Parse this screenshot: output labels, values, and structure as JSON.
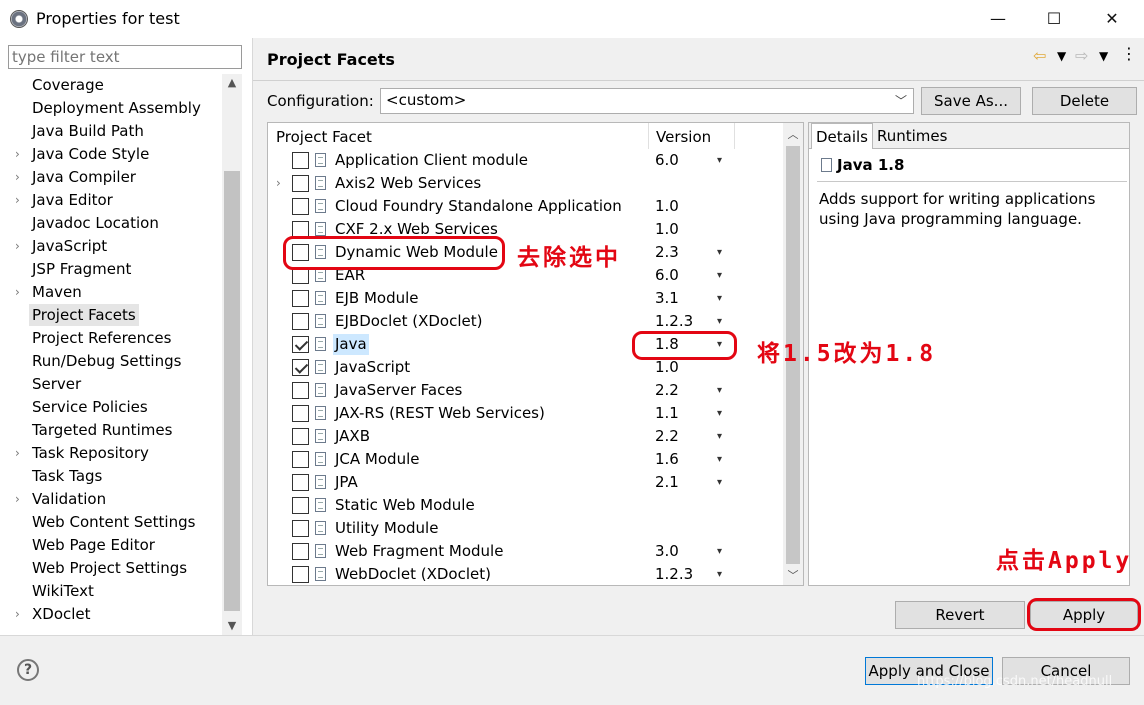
{
  "window": {
    "title": "Properties for test",
    "minimize_glyph": "—",
    "maximize_glyph": "☐",
    "close_glyph": "✕"
  },
  "filter": {
    "placeholder": "type filter text"
  },
  "tree": [
    {
      "label": "Coverage",
      "expandable": false,
      "selected": false
    },
    {
      "label": "Deployment Assembly",
      "expandable": false,
      "selected": false
    },
    {
      "label": "Java Build Path",
      "expandable": false,
      "selected": false
    },
    {
      "label": "Java Code Style",
      "expandable": true,
      "selected": false
    },
    {
      "label": "Java Compiler",
      "expandable": true,
      "selected": false
    },
    {
      "label": "Java Editor",
      "expandable": true,
      "selected": false
    },
    {
      "label": "Javadoc Location",
      "expandable": false,
      "selected": false
    },
    {
      "label": "JavaScript",
      "expandable": true,
      "selected": false
    },
    {
      "label": "JSP Fragment",
      "expandable": false,
      "selected": false
    },
    {
      "label": "Maven",
      "expandable": true,
      "selected": false
    },
    {
      "label": "Project Facets",
      "expandable": false,
      "selected": true
    },
    {
      "label": "Project References",
      "expandable": false,
      "selected": false
    },
    {
      "label": "Run/Debug Settings",
      "expandable": false,
      "selected": false
    },
    {
      "label": "Server",
      "expandable": false,
      "selected": false
    },
    {
      "label": "Service Policies",
      "expandable": false,
      "selected": false
    },
    {
      "label": "Targeted Runtimes",
      "expandable": false,
      "selected": false
    },
    {
      "label": "Task Repository",
      "expandable": true,
      "selected": false
    },
    {
      "label": "Task Tags",
      "expandable": false,
      "selected": false
    },
    {
      "label": "Validation",
      "expandable": true,
      "selected": false
    },
    {
      "label": "Web Content Settings",
      "expandable": false,
      "selected": false
    },
    {
      "label": "Web Page Editor",
      "expandable": false,
      "selected": false
    },
    {
      "label": "Web Project Settings",
      "expandable": false,
      "selected": false
    },
    {
      "label": "WikiText",
      "expandable": false,
      "selected": false
    },
    {
      "label": "XDoclet",
      "expandable": true,
      "selected": false
    }
  ],
  "page": {
    "title": "Project Facets",
    "config_label": "Configuration:",
    "config_value": "<custom>",
    "save_as": "Save As...",
    "delete": "Delete",
    "col_facet": "Project Facet",
    "col_version": "Version",
    "facets": [
      {
        "name": "Application Client module",
        "version": "6.0",
        "checked": false,
        "dropdown": true,
        "expand": false,
        "highlight": false
      },
      {
        "name": "Axis2 Web Services",
        "version": "",
        "checked": false,
        "dropdown": false,
        "expand": true,
        "highlight": false
      },
      {
        "name": "Cloud Foundry Standalone Application",
        "version": "1.0",
        "checked": false,
        "dropdown": false,
        "expand": false,
        "highlight": false
      },
      {
        "name": "CXF 2.x Web Services",
        "version": "1.0",
        "checked": false,
        "dropdown": false,
        "expand": false,
        "highlight": false
      },
      {
        "name": "Dynamic Web Module",
        "version": "2.3",
        "checked": false,
        "dropdown": true,
        "expand": false,
        "highlight": false
      },
      {
        "name": "EAR",
        "version": "6.0",
        "checked": false,
        "dropdown": true,
        "expand": false,
        "highlight": false
      },
      {
        "name": "EJB Module",
        "version": "3.1",
        "checked": false,
        "dropdown": true,
        "expand": false,
        "highlight": false
      },
      {
        "name": "EJBDoclet (XDoclet)",
        "version": "1.2.3",
        "checked": false,
        "dropdown": true,
        "expand": false,
        "highlight": false
      },
      {
        "name": "Java",
        "version": "1.8",
        "checked": true,
        "dropdown": true,
        "expand": false,
        "highlight": true
      },
      {
        "name": "JavaScript",
        "version": "1.0",
        "checked": true,
        "dropdown": false,
        "expand": false,
        "highlight": false
      },
      {
        "name": "JavaServer Faces",
        "version": "2.2",
        "checked": false,
        "dropdown": true,
        "expand": false,
        "highlight": false
      },
      {
        "name": "JAX-RS (REST Web Services)",
        "version": "1.1",
        "checked": false,
        "dropdown": true,
        "expand": false,
        "highlight": false
      },
      {
        "name": "JAXB",
        "version": "2.2",
        "checked": false,
        "dropdown": true,
        "expand": false,
        "highlight": false
      },
      {
        "name": "JCA Module",
        "version": "1.6",
        "checked": false,
        "dropdown": true,
        "expand": false,
        "highlight": false
      },
      {
        "name": "JPA",
        "version": "2.1",
        "checked": false,
        "dropdown": true,
        "expand": false,
        "highlight": false
      },
      {
        "name": "Static Web Module",
        "version": "",
        "checked": false,
        "dropdown": false,
        "expand": false,
        "highlight": false
      },
      {
        "name": "Utility Module",
        "version": "",
        "checked": false,
        "dropdown": false,
        "expand": false,
        "highlight": false
      },
      {
        "name": "Web Fragment Module",
        "version": "3.0",
        "checked": false,
        "dropdown": true,
        "expand": false,
        "highlight": false
      },
      {
        "name": "WebDoclet (XDoclet)",
        "version": "1.2.3",
        "checked": false,
        "dropdown": true,
        "expand": false,
        "highlight": false
      }
    ],
    "dropdown_glyph": "▾",
    "expand_glyph": "›",
    "tab_details": "Details",
    "tab_runtimes": "Runtimes",
    "details_title": "Java 1.8",
    "details_desc": "Adds support for writing applications using Java programming language.",
    "revert": "Revert",
    "apply": "Apply"
  },
  "footer": {
    "help": "?",
    "apply_close": "Apply and Close",
    "cancel": "Cancel",
    "watermark": "https://blog.csdn.net/headnull"
  },
  "annotations": {
    "dwm": "去除选中",
    "java": "将1.5改为1.8",
    "apply": "点击Apply"
  },
  "colors": {
    "annotation": "#e30613",
    "selection": "#cde8ff"
  }
}
